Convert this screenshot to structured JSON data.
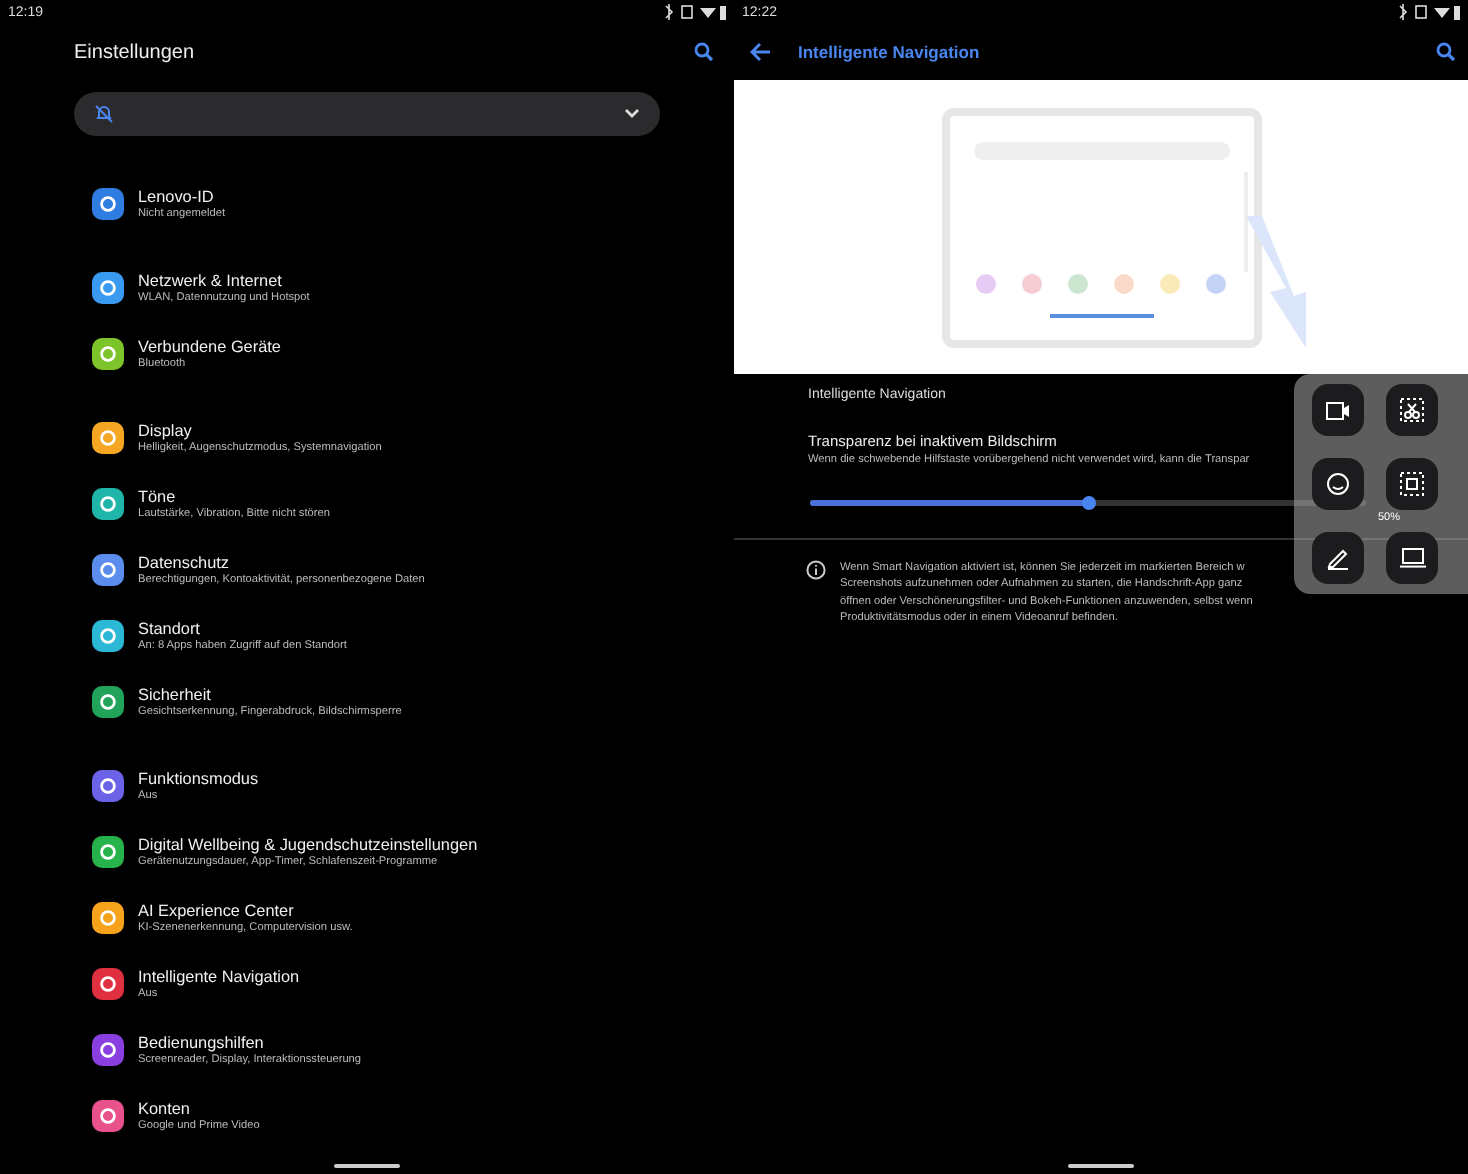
{
  "left": {
    "status_time": "12:19",
    "title": "Einstellungen",
    "groups": [
      [
        {
          "title": "Lenovo-ID",
          "subtitle": "Nicht angemeldet",
          "color": "#2f7de1"
        }
      ],
      [
        {
          "title": "Netzwerk & Internet",
          "subtitle": "WLAN, Datennutzung und Hotspot",
          "color": "#3a9af0"
        },
        {
          "title": "Verbundene Geräte",
          "subtitle": "Bluetooth",
          "color": "#7cc42a"
        }
      ],
      [
        {
          "title": "Display",
          "subtitle": "Helligkeit, Augenschutzmodus, Systemnavigation",
          "color": "#f5a623"
        },
        {
          "title": "Töne",
          "subtitle": "Lautstärke, Vibration, Bitte nicht stören",
          "color": "#1fb5a8"
        },
        {
          "title": "Datenschutz",
          "subtitle": "Berechtigungen, Kontoaktivität, personenbezogene Daten",
          "color": "#5b8def"
        },
        {
          "title": "Standort",
          "subtitle": "An: 8 Apps haben Zugriff auf den Standort",
          "color": "#2bb8d6"
        },
        {
          "title": "Sicherheit",
          "subtitle": "Gesichtserkennung, Fingerabdruck, Bildschirmsperre",
          "color": "#21a45a"
        }
      ],
      [
        {
          "title": "Funktionsmodus",
          "subtitle": "Aus",
          "color": "#6a63e8"
        },
        {
          "title": "Digital Wellbeing & Jugendschutzeinstellungen",
          "subtitle": "Gerätenutzungsdauer, App-Timer, Schlafenszeit-Programme",
          "color": "#27b34b"
        },
        {
          "title": "AI Experience Center",
          "subtitle": "KI-Szenenerkennung, Computervision usw.",
          "color": "#f6a21a"
        },
        {
          "title": "Intelligente Navigation",
          "subtitle": "Aus",
          "color": "#e0303f"
        },
        {
          "title": "Bedienungshilfen",
          "subtitle": "Screenreader, Display, Interaktionssteuerung",
          "color": "#8a3fe0"
        },
        {
          "title": "Konten",
          "subtitle": "Google und Prime Video",
          "color": "#e8518a"
        }
      ]
    ]
  },
  "right": {
    "status_time": "12:22",
    "title": "Intelligente Navigation",
    "dots": [
      {
        "color": "#e6ccf5"
      },
      {
        "color": "#f7cdd4"
      },
      {
        "color": "#cde6cf"
      },
      {
        "color": "#f9d9c8"
      },
      {
        "color": "#faeab8"
      },
      {
        "color": "#c6d3f7"
      }
    ],
    "feature_label": "Intelligente Navigation",
    "transparency": {
      "title": "Transparenz bei inaktivem Bildschirm",
      "description": "Wenn die schwebende Hilfstaste vorübergehend nicht verwendet wird, kann die Transpar",
      "level": 0.5,
      "reading": "50%"
    },
    "info_lines": [
      "Wenn Smart Navigation aktiviert ist, können Sie jederzeit im markierten Bereich w",
      "Screenshots aufzunehmen oder Aufnahmen zu starten, die Handschrift-App ganz",
      "öffnen oder Verschönerungsfilter- und Bokeh-Funktionen anzuwenden, selbst wenn",
      "Produktivitätsmodus oder in einem Videoanruf befinden."
    ],
    "panel_buttons": [
      {
        "kind": "video"
      },
      {
        "kind": "cut"
      },
      {
        "kind": "face"
      },
      {
        "kind": "crop"
      },
      {
        "kind": "pen"
      },
      {
        "kind": "screen"
      }
    ]
  }
}
